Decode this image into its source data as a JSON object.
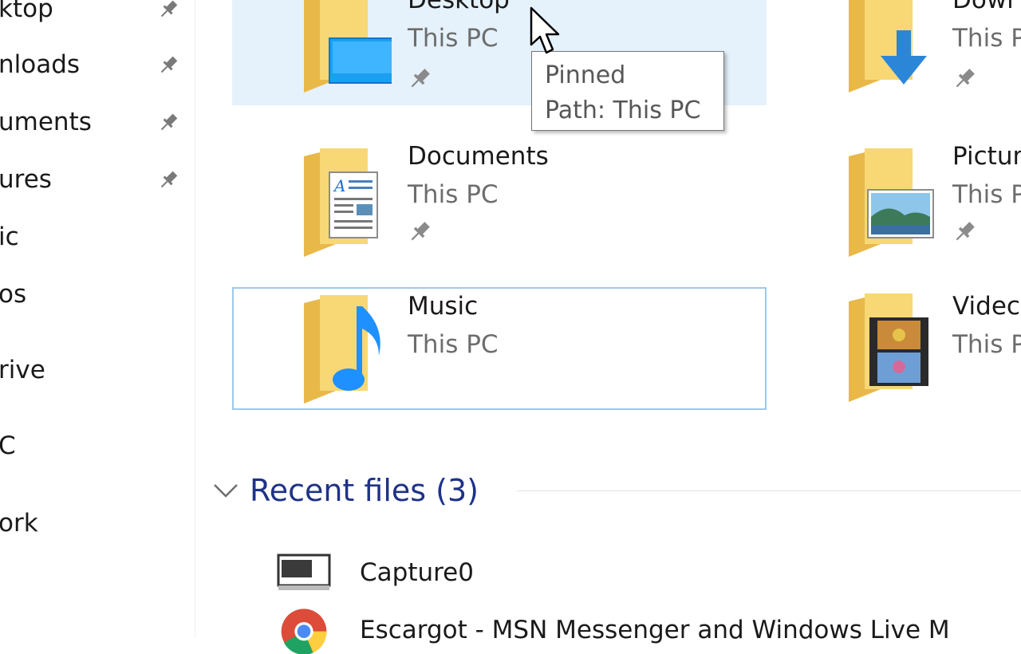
{
  "sidebar": {
    "items": [
      {
        "label": "ktop",
        "pinned": true
      },
      {
        "label": "nloads",
        "pinned": true
      },
      {
        "label": "uments",
        "pinned": true
      },
      {
        "label": "ures",
        "pinned": true
      },
      {
        "label": "ic",
        "pinned": false
      },
      {
        "label": "os",
        "pinned": false
      },
      {
        "label": "rive",
        "pinned": false
      },
      {
        "label": "C",
        "pinned": false
      },
      {
        "label": "ork",
        "pinned": false
      }
    ]
  },
  "quick_access": {
    "folders": [
      {
        "name": "Desktop",
        "location": "This PC",
        "pinned": true,
        "icon": "desktop-folder-icon"
      },
      {
        "name": "Dowr",
        "location": "This PC",
        "pinned": true,
        "icon": "downloads-folder-icon"
      },
      {
        "name": "Documents",
        "location": "This PC",
        "pinned": true,
        "icon": "documents-folder-icon"
      },
      {
        "name": "Pictur",
        "location": "This P",
        "pinned": true,
        "icon": "pictures-folder-icon"
      },
      {
        "name": "Music",
        "location": "This PC",
        "pinned": false,
        "icon": "music-folder-icon"
      },
      {
        "name": "Videc",
        "location": "This P",
        "pinned": false,
        "icon": "videos-folder-icon"
      }
    ]
  },
  "tooltip": {
    "line1": "Pinned",
    "line2": "Path: This PC"
  },
  "recent": {
    "title": "Recent files (3)",
    "items": [
      {
        "name": "Capture0",
        "icon": "image-file-icon"
      },
      {
        "name": "Escargot - MSN Messenger and Windows Live M",
        "icon": "chrome-icon"
      }
    ]
  },
  "colors": {
    "selected_bg": "#e5f1fb",
    "focus_border": "#9dc9ec",
    "section_title": "#1e3287",
    "folder_yellow": "#f8d775",
    "accent_blue": "#1e90ff"
  }
}
